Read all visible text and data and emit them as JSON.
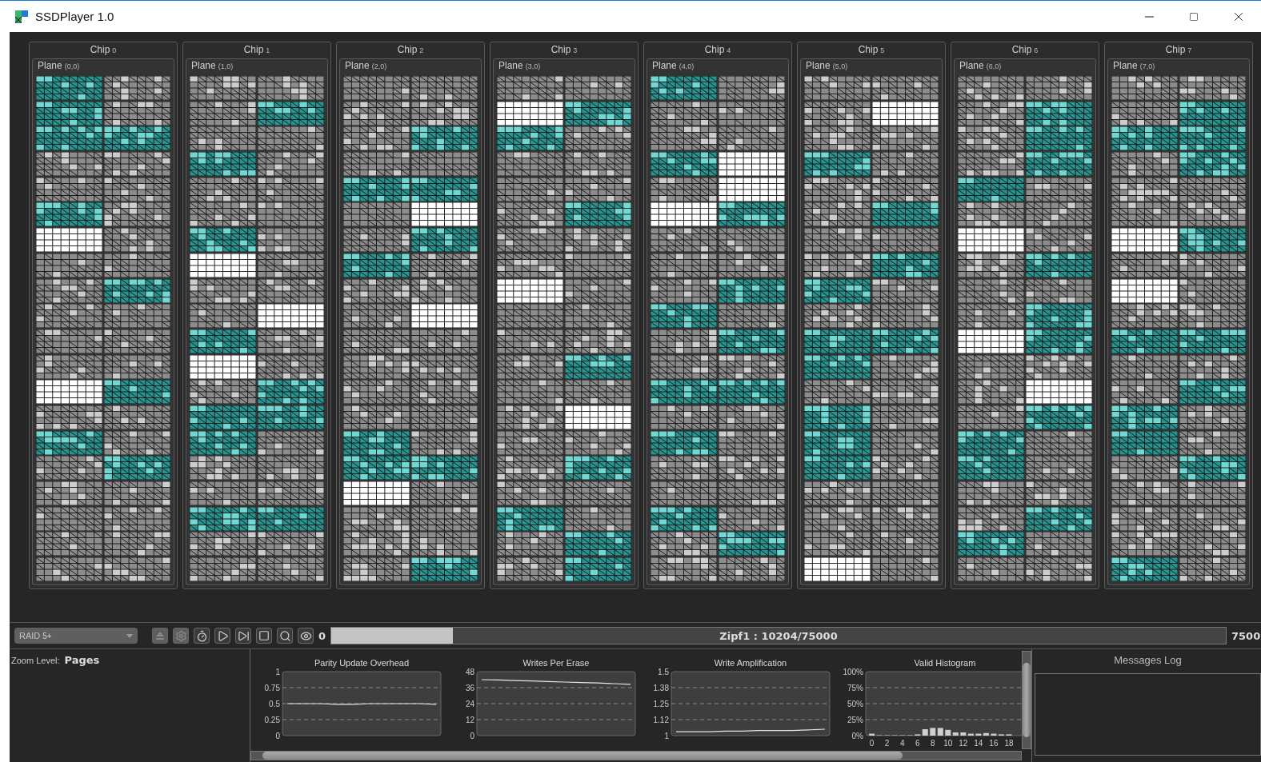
{
  "window": {
    "title": "SSDPlayer 1.0"
  },
  "chips": [
    {
      "title": "Chip",
      "number": "0",
      "plane": {
        "title": "Plane",
        "coords": "(0,0)",
        "columns": [
          [
            {
              "kind": "active"
            },
            {
              "kind": "active"
            },
            {
              "kind": "active"
            },
            {
              "kind": "used"
            },
            {
              "kind": "used"
            },
            {
              "kind": "active"
            },
            {
              "kind": "free"
            },
            {
              "kind": "used"
            },
            {
              "kind": "used"
            },
            {
              "kind": "used"
            },
            {
              "kind": "used"
            },
            {
              "kind": "used"
            },
            {
              "kind": "free"
            },
            {
              "kind": "used"
            },
            {
              "kind": "active"
            },
            {
              "kind": "used"
            },
            {
              "kind": "used"
            },
            {
              "kind": "used"
            },
            {
              "kind": "used"
            },
            {
              "kind": "used"
            }
          ],
          [
            {
              "kind": "used"
            },
            {
              "kind": "used"
            },
            {
              "kind": "active"
            },
            {
              "kind": "used"
            },
            {
              "kind": "used"
            },
            {
              "kind": "used"
            },
            {
              "kind": "used"
            },
            {
              "kind": "used"
            },
            {
              "kind": "active"
            },
            {
              "kind": "used"
            },
            {
              "kind": "used"
            },
            {
              "kind": "used"
            },
            {
              "kind": "active"
            },
            {
              "kind": "used"
            },
            {
              "kind": "used"
            },
            {
              "kind": "active"
            },
            {
              "kind": "used"
            },
            {
              "kind": "used"
            },
            {
              "kind": "used"
            },
            {
              "kind": "used"
            }
          ]
        ]
      }
    },
    {
      "title": "Chip",
      "number": "1",
      "plane": {
        "title": "Plane",
        "coords": "(1,0)",
        "columns": [
          [
            {
              "kind": "used"
            },
            {
              "kind": "used"
            },
            {
              "kind": "used"
            },
            {
              "kind": "active"
            },
            {
              "kind": "used"
            },
            {
              "kind": "used"
            },
            {
              "kind": "active"
            },
            {
              "kind": "free"
            },
            {
              "kind": "used"
            },
            {
              "kind": "used"
            },
            {
              "kind": "active"
            },
            {
              "kind": "free"
            },
            {
              "kind": "used"
            },
            {
              "kind": "active"
            },
            {
              "kind": "active"
            },
            {
              "kind": "used"
            },
            {
              "kind": "used"
            },
            {
              "kind": "active"
            },
            {
              "kind": "used"
            },
            {
              "kind": "used"
            }
          ],
          [
            {
              "kind": "used"
            },
            {
              "kind": "active"
            },
            {
              "kind": "used"
            },
            {
              "kind": "used"
            },
            {
              "kind": "used"
            },
            {
              "kind": "used"
            },
            {
              "kind": "used"
            },
            {
              "kind": "used"
            },
            {
              "kind": "used"
            },
            {
              "kind": "free"
            },
            {
              "kind": "used"
            },
            {
              "kind": "used"
            },
            {
              "kind": "active"
            },
            {
              "kind": "active"
            },
            {
              "kind": "used"
            },
            {
              "kind": "used"
            },
            {
              "kind": "used"
            },
            {
              "kind": "active"
            },
            {
              "kind": "used"
            },
            {
              "kind": "used"
            }
          ]
        ]
      }
    },
    {
      "title": "Chip",
      "number": "2",
      "plane": {
        "title": "Plane",
        "coords": "(2,0)",
        "columns": [
          [
            {
              "kind": "used"
            },
            {
              "kind": "used"
            },
            {
              "kind": "used"
            },
            {
              "kind": "used"
            },
            {
              "kind": "active"
            },
            {
              "kind": "used"
            },
            {
              "kind": "used"
            },
            {
              "kind": "active"
            },
            {
              "kind": "used"
            },
            {
              "kind": "used"
            },
            {
              "kind": "used"
            },
            {
              "kind": "used"
            },
            {
              "kind": "used"
            },
            {
              "kind": "used"
            },
            {
              "kind": "active"
            },
            {
              "kind": "active"
            },
            {
              "kind": "free"
            },
            {
              "kind": "used"
            },
            {
              "kind": "used"
            },
            {
              "kind": "used"
            }
          ],
          [
            {
              "kind": "used"
            },
            {
              "kind": "used"
            },
            {
              "kind": "active"
            },
            {
              "kind": "used"
            },
            {
              "kind": "active"
            },
            {
              "kind": "free"
            },
            {
              "kind": "active"
            },
            {
              "kind": "used"
            },
            {
              "kind": "used"
            },
            {
              "kind": "free"
            },
            {
              "kind": "used"
            },
            {
              "kind": "used"
            },
            {
              "kind": "used"
            },
            {
              "kind": "used"
            },
            {
              "kind": "used"
            },
            {
              "kind": "active"
            },
            {
              "kind": "used"
            },
            {
              "kind": "used"
            },
            {
              "kind": "used"
            },
            {
              "kind": "active"
            }
          ]
        ]
      }
    },
    {
      "title": "Chip",
      "number": "3",
      "plane": {
        "title": "Plane",
        "coords": "(3,0)",
        "columns": [
          [
            {
              "kind": "used"
            },
            {
              "kind": "free"
            },
            {
              "kind": "active"
            },
            {
              "kind": "used"
            },
            {
              "kind": "used"
            },
            {
              "kind": "used"
            },
            {
              "kind": "used"
            },
            {
              "kind": "used"
            },
            {
              "kind": "free"
            },
            {
              "kind": "used"
            },
            {
              "kind": "used"
            },
            {
              "kind": "used"
            },
            {
              "kind": "used"
            },
            {
              "kind": "used"
            },
            {
              "kind": "used"
            },
            {
              "kind": "used"
            },
            {
              "kind": "used"
            },
            {
              "kind": "active"
            },
            {
              "kind": "used"
            },
            {
              "kind": "used"
            }
          ],
          [
            {
              "kind": "used"
            },
            {
              "kind": "active"
            },
            {
              "kind": "used"
            },
            {
              "kind": "used"
            },
            {
              "kind": "used"
            },
            {
              "kind": "active"
            },
            {
              "kind": "used"
            },
            {
              "kind": "used"
            },
            {
              "kind": "used"
            },
            {
              "kind": "used"
            },
            {
              "kind": "used"
            },
            {
              "kind": "active"
            },
            {
              "kind": "used"
            },
            {
              "kind": "free"
            },
            {
              "kind": "used"
            },
            {
              "kind": "active"
            },
            {
              "kind": "used"
            },
            {
              "kind": "used"
            },
            {
              "kind": "active"
            },
            {
              "kind": "active"
            }
          ]
        ]
      }
    },
    {
      "title": "Chip",
      "number": "4",
      "plane": {
        "title": "Plane",
        "coords": "(4,0)",
        "columns": [
          [
            {
              "kind": "active"
            },
            {
              "kind": "used"
            },
            {
              "kind": "used"
            },
            {
              "kind": "active"
            },
            {
              "kind": "used"
            },
            {
              "kind": "free"
            },
            {
              "kind": "used"
            },
            {
              "kind": "used"
            },
            {
              "kind": "used"
            },
            {
              "kind": "active"
            },
            {
              "kind": "used"
            },
            {
              "kind": "used"
            },
            {
              "kind": "active"
            },
            {
              "kind": "used"
            },
            {
              "kind": "active"
            },
            {
              "kind": "used"
            },
            {
              "kind": "used"
            },
            {
              "kind": "active"
            },
            {
              "kind": "used"
            },
            {
              "kind": "used"
            }
          ],
          [
            {
              "kind": "used"
            },
            {
              "kind": "used"
            },
            {
              "kind": "used"
            },
            {
              "kind": "free"
            },
            {
              "kind": "free"
            },
            {
              "kind": "active"
            },
            {
              "kind": "used"
            },
            {
              "kind": "used"
            },
            {
              "kind": "active"
            },
            {
              "kind": "used"
            },
            {
              "kind": "active"
            },
            {
              "kind": "used"
            },
            {
              "kind": "active"
            },
            {
              "kind": "used"
            },
            {
              "kind": "used"
            },
            {
              "kind": "used"
            },
            {
              "kind": "used"
            },
            {
              "kind": "used"
            },
            {
              "kind": "active"
            },
            {
              "kind": "used"
            }
          ]
        ]
      }
    },
    {
      "title": "Chip",
      "number": "5",
      "plane": {
        "title": "Plane",
        "coords": "(5,0)",
        "columns": [
          [
            {
              "kind": "used"
            },
            {
              "kind": "used"
            },
            {
              "kind": "used"
            },
            {
              "kind": "active"
            },
            {
              "kind": "used"
            },
            {
              "kind": "used"
            },
            {
              "kind": "used"
            },
            {
              "kind": "used"
            },
            {
              "kind": "active"
            },
            {
              "kind": "used"
            },
            {
              "kind": "active"
            },
            {
              "kind": "active"
            },
            {
              "kind": "used"
            },
            {
              "kind": "active"
            },
            {
              "kind": "active"
            },
            {
              "kind": "active"
            },
            {
              "kind": "used"
            },
            {
              "kind": "used"
            },
            {
              "kind": "used"
            },
            {
              "kind": "free"
            }
          ],
          [
            {
              "kind": "used"
            },
            {
              "kind": "free"
            },
            {
              "kind": "used"
            },
            {
              "kind": "used"
            },
            {
              "kind": "used"
            },
            {
              "kind": "active"
            },
            {
              "kind": "used"
            },
            {
              "kind": "active"
            },
            {
              "kind": "used"
            },
            {
              "kind": "used"
            },
            {
              "kind": "active"
            },
            {
              "kind": "used"
            },
            {
              "kind": "used"
            },
            {
              "kind": "used"
            },
            {
              "kind": "used"
            },
            {
              "kind": "used"
            },
            {
              "kind": "used"
            },
            {
              "kind": "used"
            },
            {
              "kind": "used"
            },
            {
              "kind": "used"
            }
          ]
        ]
      }
    },
    {
      "title": "Chip",
      "number": "6",
      "plane": {
        "title": "Plane",
        "coords": "(6,0)",
        "columns": [
          [
            {
              "kind": "used"
            },
            {
              "kind": "used"
            },
            {
              "kind": "used"
            },
            {
              "kind": "used"
            },
            {
              "kind": "active"
            },
            {
              "kind": "used"
            },
            {
              "kind": "free"
            },
            {
              "kind": "used"
            },
            {
              "kind": "used"
            },
            {
              "kind": "used"
            },
            {
              "kind": "free"
            },
            {
              "kind": "used"
            },
            {
              "kind": "used"
            },
            {
              "kind": "used"
            },
            {
              "kind": "active"
            },
            {
              "kind": "active"
            },
            {
              "kind": "used"
            },
            {
              "kind": "used"
            },
            {
              "kind": "active"
            },
            {
              "kind": "used"
            }
          ],
          [
            {
              "kind": "used"
            },
            {
              "kind": "active"
            },
            {
              "kind": "active"
            },
            {
              "kind": "active"
            },
            {
              "kind": "used"
            },
            {
              "kind": "used"
            },
            {
              "kind": "used"
            },
            {
              "kind": "active"
            },
            {
              "kind": "used"
            },
            {
              "kind": "active"
            },
            {
              "kind": "active"
            },
            {
              "kind": "used"
            },
            {
              "kind": "free"
            },
            {
              "kind": "active"
            },
            {
              "kind": "used"
            },
            {
              "kind": "used"
            },
            {
              "kind": "used"
            },
            {
              "kind": "active"
            },
            {
              "kind": "used"
            },
            {
              "kind": "used"
            }
          ]
        ]
      }
    },
    {
      "title": "Chip",
      "number": "7",
      "plane": {
        "title": "Plane",
        "coords": "(7,0)",
        "columns": [
          [
            {
              "kind": "used"
            },
            {
              "kind": "used"
            },
            {
              "kind": "active"
            },
            {
              "kind": "used"
            },
            {
              "kind": "used"
            },
            {
              "kind": "used"
            },
            {
              "kind": "free"
            },
            {
              "kind": "used"
            },
            {
              "kind": "free"
            },
            {
              "kind": "used"
            },
            {
              "kind": "active"
            },
            {
              "kind": "used"
            },
            {
              "kind": "used"
            },
            {
              "kind": "active"
            },
            {
              "kind": "active"
            },
            {
              "kind": "used"
            },
            {
              "kind": "used"
            },
            {
              "kind": "used"
            },
            {
              "kind": "used"
            },
            {
              "kind": "active"
            }
          ],
          [
            {
              "kind": "used"
            },
            {
              "kind": "active"
            },
            {
              "kind": "active"
            },
            {
              "kind": "active"
            },
            {
              "kind": "used"
            },
            {
              "kind": "used"
            },
            {
              "kind": "active"
            },
            {
              "kind": "used"
            },
            {
              "kind": "used"
            },
            {
              "kind": "used"
            },
            {
              "kind": "active"
            },
            {
              "kind": "used"
            },
            {
              "kind": "active"
            },
            {
              "kind": "used"
            },
            {
              "kind": "used"
            },
            {
              "kind": "active"
            },
            {
              "kind": "used"
            },
            {
              "kind": "used"
            },
            {
              "kind": "used"
            },
            {
              "kind": "used"
            }
          ]
        ]
      }
    }
  ],
  "toolbar": {
    "dropdown": {
      "value": "RAID",
      "suffix": "5+",
      "disabled": true
    },
    "buttons": [
      {
        "kind": "eject",
        "disabled": true
      },
      {
        "kind": "gear",
        "disabled": true
      },
      {
        "kind": "stopwatch",
        "disabled": false
      },
      {
        "kind": "play",
        "disabled": false
      },
      {
        "kind": "step",
        "disabled": false
      },
      {
        "kind": "stop",
        "disabled": false
      },
      {
        "kind": "zoom",
        "disabled": false
      },
      {
        "kind": "eye",
        "disabled": false
      }
    ],
    "counter": "0",
    "progress": {
      "level": 0.136,
      "label": "Zipf1 : 10204/75000"
    },
    "total": "7500"
  },
  "zoom_level": {
    "label": "Zoom Level:",
    "value": "Pages"
  },
  "charts": [
    {
      "chart_data": {
        "type": "line",
        "title": "Parity Update Overhead",
        "grid": true,
        "ylim": [
          0,
          1
        ],
        "yticks": [
          0,
          0.25,
          0.5,
          0.75,
          1
        ],
        "series": [
          {
            "color": "#e6e6e6",
            "values": [
              0.5,
              0.5,
              0.5,
              0.49,
              0.49,
              0.5,
              0.5,
              0.5,
              0.5,
              0.49
            ]
          }
        ]
      }
    },
    {
      "chart_data": {
        "type": "line",
        "title": "Writes Per Erase",
        "grid": true,
        "ylim": [
          0,
          48
        ],
        "yticks": [
          0,
          12,
          24,
          36,
          48
        ],
        "series": [
          {
            "color": "#e6e6e6",
            "values": [
              42,
              41.8,
              41.3,
              41,
              40.6,
              40.2,
              39.8,
              39.5,
              39,
              38.5
            ]
          }
        ]
      }
    },
    {
      "chart_data": {
        "type": "line",
        "title": "Write Amplification",
        "grid": true,
        "ylim": [
          1,
          1.5
        ],
        "yticks": [
          {
            "value": 1,
            "label": "1"
          },
          {
            "value": 1.125,
            "label": "1.12"
          },
          {
            "value": 1.25,
            "label": "1.25"
          },
          {
            "value": 1.375,
            "label": "1.38"
          },
          {
            "value": 1.5,
            "label": "1.5"
          }
        ],
        "series": [
          {
            "color": "#e6e6e6",
            "values": [
              1.03,
              1.03,
              1.03,
              1.035,
              1.035,
              1.04,
              1.04,
              1.04,
              1.045,
              1.05
            ]
          }
        ]
      }
    },
    {
      "chart_data": {
        "type": "bar",
        "title": "Valid Histogram",
        "grid": true,
        "xlim": [
          -0.8,
          20
        ],
        "x": [
          0,
          1,
          2,
          3,
          4,
          5,
          6,
          7,
          8,
          9,
          10,
          11,
          12,
          13,
          14,
          15,
          16,
          17,
          18
        ],
        "values": [
          3,
          0,
          0,
          0,
          0,
          0,
          2,
          10,
          12,
          12,
          9,
          5,
          5,
          3,
          3,
          4,
          3,
          2,
          2
        ],
        "ylim": [
          0,
          100
        ],
        "yticks": [
          {
            "value": 0,
            "label": "0%"
          },
          {
            "value": 25,
            "label": "25%"
          },
          {
            "value": 50,
            "label": "50%"
          },
          {
            "value": 75,
            "label": "75%"
          },
          {
            "value": 100,
            "label": "100%"
          }
        ],
        "xticks": [
          0,
          2,
          4,
          6,
          8,
          10,
          12,
          14,
          16,
          18
        ]
      }
    }
  ],
  "messages_log": {
    "title": "Messages Log"
  }
}
